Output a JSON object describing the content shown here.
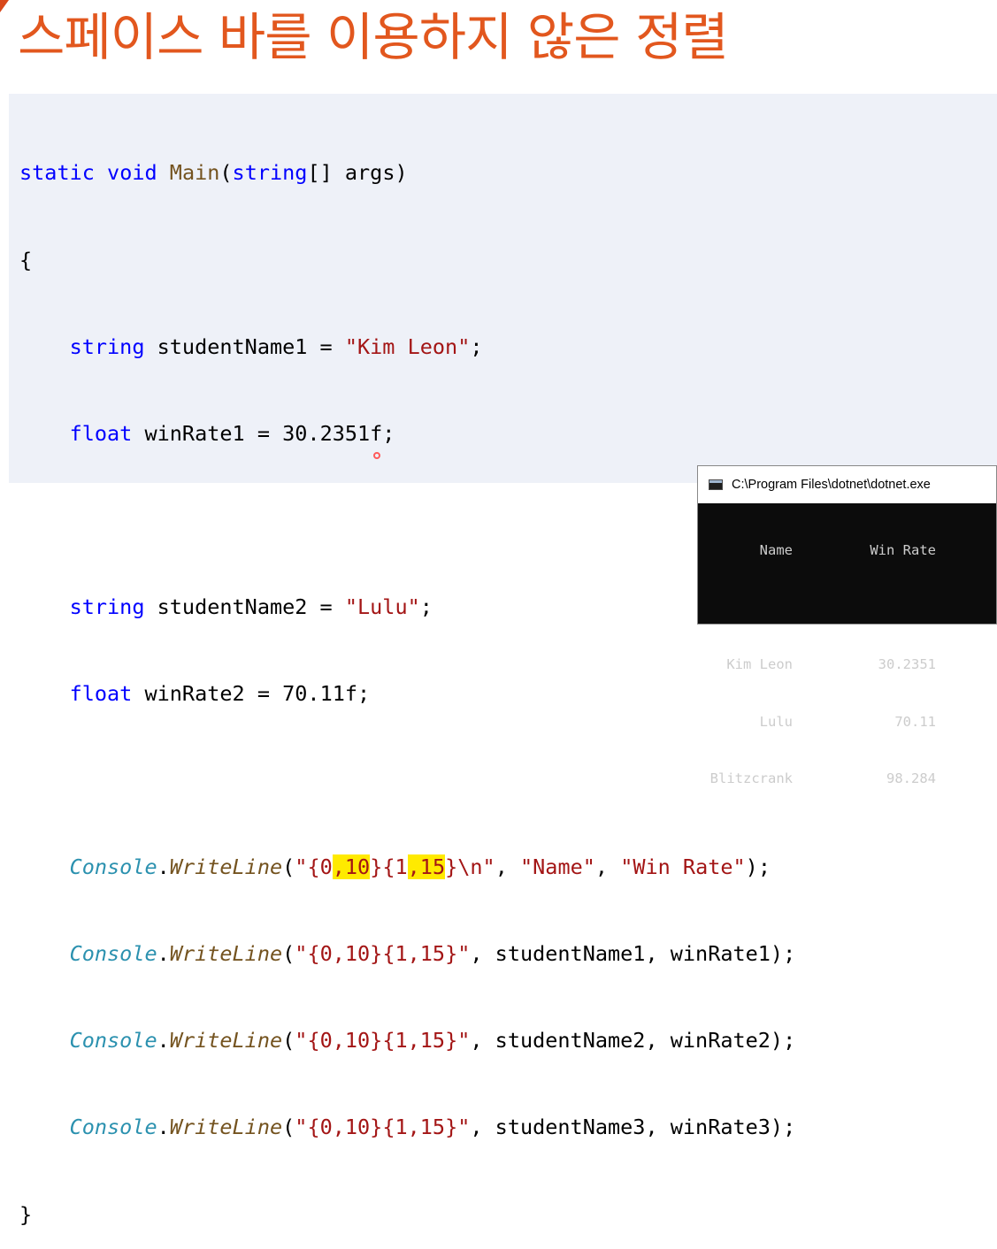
{
  "slide": {
    "title": "스페이스 바를 이용하지 않은 정렬"
  },
  "code": {
    "line1": {
      "kw1": "static",
      "kw2": "void",
      "fn": "Main",
      "p1": "(",
      "ty": "string",
      "rest": "[] args)"
    },
    "line2": "{",
    "line3": {
      "ty": "string",
      "rest": " studentName1 = ",
      "str": "\"Kim Leon\"",
      "end": ";"
    },
    "line4": {
      "ty": "float",
      "rest": " winRate1 = 30.2351f;"
    },
    "line6": {
      "ty": "string",
      "rest": " studentName2 = ",
      "str": "\"Lulu\"",
      "end": ";"
    },
    "line7": {
      "ty": "float",
      "rest": " winRate2 = 70.11f;"
    },
    "line9": {
      "cls": "Console",
      "dot": ".",
      "mth": "WriteLine",
      "open": "(",
      "s1": "\"{0",
      "h1": ",10",
      "s2": "}{1",
      "h2": ",15",
      "s3": "}\\n\"",
      "sep1": ", ",
      "arg1": "\"Name\"",
      "sep2": ", ",
      "arg2": "\"Win Rate\"",
      "close": ");"
    },
    "line10": {
      "cls": "Console",
      "dot": ".",
      "mth": "WriteLine",
      "open": "(",
      "fmt": "\"{0,10}{1,15}\"",
      "args": ", studentName1, winRate1);"
    },
    "line11": {
      "cls": "Console",
      "dot": ".",
      "mth": "WriteLine",
      "open": "(",
      "fmt": "\"{0,10}{1,15}\"",
      "args": ", studentName2, winRate2);"
    },
    "line12": {
      "cls": "Console",
      "dot": ".",
      "mth": "WriteLine",
      "open": "(",
      "fmt": "\"{0,10}{1,15}\"",
      "args": ", studentName3, winRate3);"
    },
    "line13": "}"
  },
  "console": {
    "title": "C:\\Program Files\\dotnet\\dotnet.exe",
    "header": {
      "name": "Name",
      "rate": "Win Rate"
    },
    "rows": [
      {
        "name": "Kim Leon",
        "rate": "30.2351"
      },
      {
        "name": "Lulu",
        "rate": "70.11"
      },
      {
        "name": "Blitzcrank",
        "rate": "98.284"
      }
    ]
  }
}
